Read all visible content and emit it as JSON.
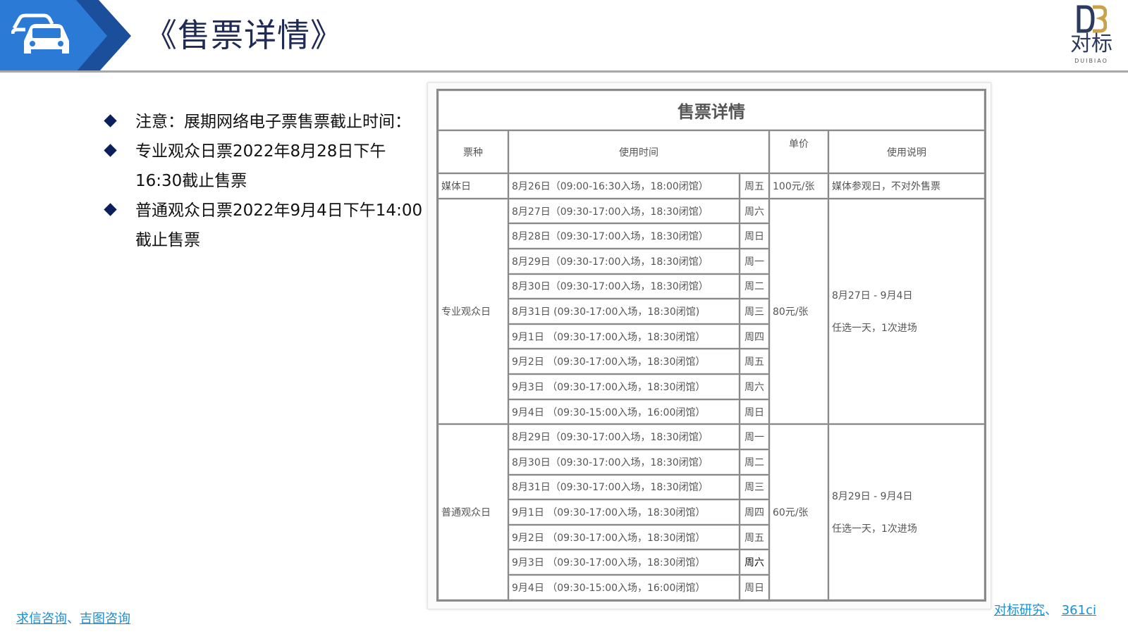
{
  "header": {
    "title": "《售票详情》",
    "logo_text": "对标",
    "logo_sub": "DUIBIAO",
    "colors": {
      "band_primary": "#1f6fd1",
      "band_dark": "#1b4f9c",
      "title": "#1f2a55"
    }
  },
  "notes": [
    "注意：展期网络电子票售票截止时间：",
    "专业观众日票2022年8月28日下午16:30截止售票",
    "普通观众日票2022年9月4日下午14:00截止售票"
  ],
  "table": {
    "title": "售票详情",
    "headers": {
      "type": "票种",
      "time": "使用时间",
      "price": "单价",
      "note": "使用说明"
    },
    "media": {
      "type": "媒体日",
      "time": "8月26日（09:00-16:30入场，18:00闭馆）",
      "day": "周五",
      "price": "100元/张",
      "note": "媒体参观日，不对外售票"
    },
    "pro": {
      "type": "专业观众日",
      "price": "80元/张",
      "note_range": "8月27日 - 9月4日",
      "note_rule": "任选一天，1次进场",
      "rows": [
        {
          "time": "8月27日（09:30-17:00入场，18:30闭馆）",
          "day": "周六"
        },
        {
          "time": "8月28日（09:30-17:00入场，18:30闭馆）",
          "day": "周日"
        },
        {
          "time": "8月29日（09:30-17:00入场，18:30闭馆）",
          "day": "周一"
        },
        {
          "time": "8月30日（09:30-17:00入场，18:30闭馆）",
          "day": "周二"
        },
        {
          "time": "8月31日 (09:30-17:00入场，18:30闭馆)",
          "day": "周三"
        },
        {
          "time": "9月1日 （09:30-17:00入场，18:30闭馆）",
          "day": "周四"
        },
        {
          "time": "9月2日 （09:30-17:00入场，18:30闭馆）",
          "day": "周五"
        },
        {
          "time": "9月3日 （09:30-17:00入场，18:30闭馆）",
          "day": "周六"
        },
        {
          "time": "9月4日 （09:30-15:00入场，16:00闭馆）",
          "day": "周日"
        }
      ]
    },
    "general": {
      "type": "普通观众日",
      "price": "60元/张",
      "note_range": "8月29日 - 9月4日",
      "note_rule": "任选一天，1次进场",
      "rows": [
        {
          "time": "8月29日（09:30-17:00入场，18:30闭馆）",
          "day": "周一"
        },
        {
          "time": "8月30日（09:30-17:00入场，18:30闭馆）",
          "day": "周二"
        },
        {
          "time": "8月31日（09:30-17:00入场，18:30闭馆）",
          "day": "周三"
        },
        {
          "time": "9月1日 （09:30-17:00入场，18:30闭馆）",
          "day": "周四"
        },
        {
          "time": "9月2日 （09:30-17:00入场，18:30闭馆）",
          "day": "周五"
        },
        {
          "time": "9月3日 （09:30-17:00入场，18:30闭馆）",
          "day": "周六"
        },
        {
          "time": "9月4日 （09:30-15:00入场，16:00闭馆）",
          "day": "周日"
        }
      ]
    }
  },
  "footer": {
    "left_link1": "求信咨询",
    "left_sep": "、",
    "left_link2": "吉图咨询",
    "right_link1": "对标研究",
    "right_sep": "、 ",
    "right_link2": "361ci"
  }
}
